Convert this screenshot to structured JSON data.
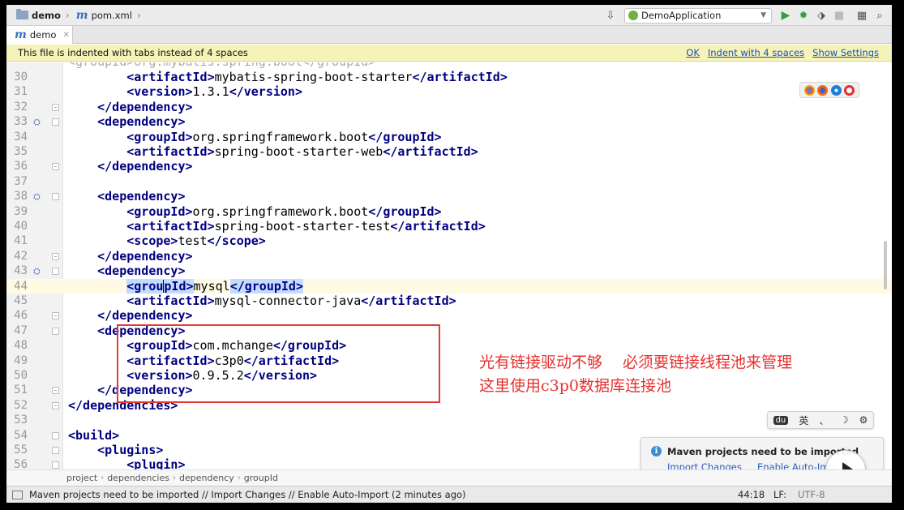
{
  "navbar": {
    "breadcrumb": [
      "demo",
      "pom.xml"
    ],
    "run_config": "DemoApplication"
  },
  "tabs": [
    {
      "label": "demo"
    }
  ],
  "banner": {
    "message": "This file is indented with tabs instead of 4 spaces",
    "actions": [
      "OK",
      "Indent with 4 spaces",
      "Show Settings"
    ]
  },
  "editor": {
    "top_partial": "<groupId>org.mybatis.spring.boot</groupId>",
    "lines": [
      {
        "n": "30",
        "pre": "        ",
        "tokens": [
          [
            "t",
            "<artifactId>"
          ],
          [
            "x",
            "mybatis-spring-boot-starter"
          ],
          [
            "t",
            "</artifactId>"
          ]
        ]
      },
      {
        "n": "31",
        "pre": "        ",
        "tokens": [
          [
            "t",
            "<version>"
          ],
          [
            "x",
            "1.3.1"
          ],
          [
            "t",
            "</version>"
          ]
        ]
      },
      {
        "n": "32",
        "pre": "    ",
        "tokens": [
          [
            "t",
            "</dependency>"
          ]
        ],
        "fold": "end"
      },
      {
        "n": "33",
        "pre": "    ",
        "tokens": [
          [
            "t",
            "<dependency>"
          ]
        ],
        "fold": "start",
        "mark": true
      },
      {
        "n": "34",
        "pre": "        ",
        "tokens": [
          [
            "t",
            "<groupId>"
          ],
          [
            "x",
            "org.springframework.boot"
          ],
          [
            "t",
            "</groupId>"
          ]
        ]
      },
      {
        "n": "35",
        "pre": "        ",
        "tokens": [
          [
            "t",
            "<artifactId>"
          ],
          [
            "x",
            "spring-boot-starter-web"
          ],
          [
            "t",
            "</artifactId>"
          ]
        ]
      },
      {
        "n": "36",
        "pre": "    ",
        "tokens": [
          [
            "t",
            "</dependency>"
          ]
        ],
        "fold": "end"
      },
      {
        "n": "37",
        "pre": "",
        "tokens": []
      },
      {
        "n": "38",
        "pre": "    ",
        "tokens": [
          [
            "t",
            "<dependency>"
          ]
        ],
        "fold": "start",
        "mark": true
      },
      {
        "n": "39",
        "pre": "        ",
        "tokens": [
          [
            "t",
            "<groupId>"
          ],
          [
            "x",
            "org.springframework.boot"
          ],
          [
            "t",
            "</groupId>"
          ]
        ]
      },
      {
        "n": "40",
        "pre": "        ",
        "tokens": [
          [
            "t",
            "<artifactId>"
          ],
          [
            "x",
            "spring-boot-starter-test"
          ],
          [
            "t",
            "</artifactId>"
          ]
        ]
      },
      {
        "n": "41",
        "pre": "        ",
        "tokens": [
          [
            "t",
            "<scope>"
          ],
          [
            "x",
            "test"
          ],
          [
            "t",
            "</scope>"
          ]
        ]
      },
      {
        "n": "42",
        "pre": "    ",
        "tokens": [
          [
            "t",
            "</dependency>"
          ]
        ],
        "fold": "end"
      },
      {
        "n": "43",
        "pre": "    ",
        "tokens": [
          [
            "t",
            "<dependency>"
          ]
        ],
        "fold": "start",
        "mark": true
      },
      {
        "n": "44",
        "pre": "        ",
        "tokens": [
          [
            "b",
            "<grou"
          ],
          [
            "c",
            ""
          ],
          [
            "b",
            "pId>"
          ],
          [
            "x",
            "mysql"
          ],
          [
            "b",
            "</groupId>"
          ]
        ],
        "current": true
      },
      {
        "n": "45",
        "pre": "        ",
        "tokens": [
          [
            "t",
            "<artifactId>"
          ],
          [
            "x",
            "mysql-connector-java"
          ],
          [
            "t",
            "</artifactId>"
          ]
        ]
      },
      {
        "n": "46",
        "pre": "    ",
        "tokens": [
          [
            "t",
            "</dependency>"
          ]
        ],
        "fold": "end"
      },
      {
        "n": "47",
        "pre": "    ",
        "tokens": [
          [
            "t",
            "<dependency>"
          ]
        ],
        "fold": "start"
      },
      {
        "n": "48",
        "pre": "        ",
        "tokens": [
          [
            "t",
            "<groupId>"
          ],
          [
            "x",
            "com.mchange"
          ],
          [
            "t",
            "</groupId>"
          ]
        ]
      },
      {
        "n": "49",
        "pre": "        ",
        "tokens": [
          [
            "t",
            "<artifactId>"
          ],
          [
            "x",
            "c3p0"
          ],
          [
            "t",
            "</artifactId>"
          ]
        ]
      },
      {
        "n": "50",
        "pre": "        ",
        "tokens": [
          [
            "t",
            "<version>"
          ],
          [
            "x",
            "0.9.5.2"
          ],
          [
            "t",
            "</version>"
          ]
        ]
      },
      {
        "n": "51",
        "pre": "    ",
        "tokens": [
          [
            "t",
            "</dependency>"
          ]
        ],
        "fold": "end"
      },
      {
        "n": "52",
        "pre": "",
        "tokens": [
          [
            "t",
            "</dependencies>"
          ]
        ],
        "fold": "end"
      },
      {
        "n": "53",
        "pre": "",
        "tokens": []
      },
      {
        "n": "54",
        "pre": "",
        "tokens": [
          [
            "t",
            "<build>"
          ]
        ],
        "fold": "start"
      },
      {
        "n": "55",
        "pre": "    ",
        "tokens": [
          [
            "t",
            "<plugins>"
          ]
        ],
        "fold": "start"
      },
      {
        "n": "56",
        "pre": "        ",
        "tokens": [
          [
            "t",
            "<plugin>"
          ]
        ],
        "fold": "start"
      }
    ]
  },
  "annotation": {
    "line1": "光有链接驱动不够　 必须要链接线程池来管理",
    "line2": "这里使用c3p0数据库连接池"
  },
  "ime_bar": {
    "items": [
      "du",
      "英",
      "、",
      "☽",
      "⚙"
    ]
  },
  "maven_popup": {
    "title": "Maven projects need to be imported",
    "import_changes": "Import Changes",
    "enable_auto_import": "Enable Auto-Imp"
  },
  "path_bar": [
    "project",
    "dependencies",
    "dependency",
    "groupId"
  ],
  "status_bar": {
    "message": "Maven projects need to be imported // Import Changes // Enable Auto-Import (2 minutes ago)",
    "position": "44:18",
    "line_sep": "LF:",
    "encoding": "UTF-8"
  },
  "colors": {
    "tag": "#000080",
    "annotation": "#e5312e",
    "banner": "#f6f3b9",
    "link": "#1e4fbf"
  }
}
